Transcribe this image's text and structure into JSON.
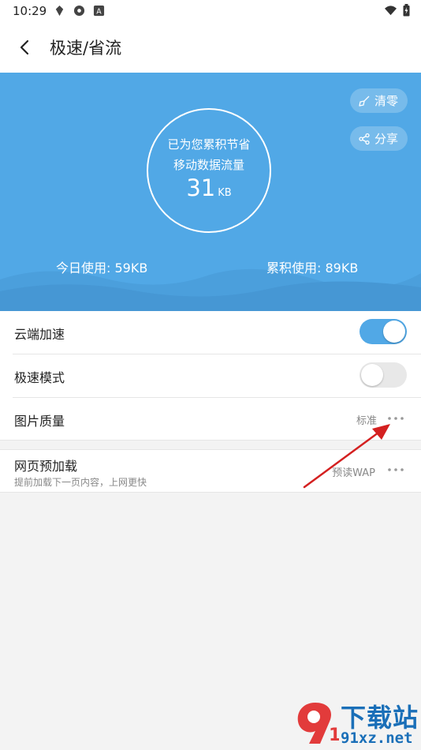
{
  "status_bar": {
    "time": "10:29"
  },
  "app_bar": {
    "title": "极速/省流"
  },
  "hero": {
    "line1": "已为您累积节省",
    "line2": "移动数据流量",
    "saved_value": "31",
    "saved_unit": "KB",
    "clear_label": "清零",
    "share_label": "分享",
    "today_usage": "今日使用: 59KB",
    "total_usage": "累积使用: 89KB"
  },
  "settings": {
    "cloud_accel": {
      "label": "云端加速",
      "enabled": true
    },
    "speed_mode": {
      "label": "极速模式",
      "enabled": false
    },
    "image_quality": {
      "label": "图片质量",
      "value": "标准"
    },
    "preload": {
      "title": "网页预加载",
      "subtitle": "提前加载下一页内容，上网更快",
      "value": "预读WAP"
    }
  },
  "watermark": {
    "title": "下载站",
    "url": "91xz.net"
  },
  "colors": {
    "accent": "#51a8e6",
    "annotation_arrow": "#d42020",
    "watermark": "#1a6fb8"
  }
}
